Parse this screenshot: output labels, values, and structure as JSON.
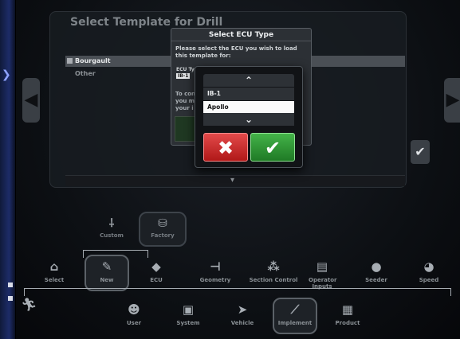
{
  "background_screen": {
    "title": "Select Template for Drill",
    "rows": [
      "Bourgault",
      "Other"
    ]
  },
  "dialog": {
    "title": "Select ECU Type",
    "message": "Please select the ECU you wish to load this template for:",
    "ecu_label": "ECU Ty",
    "ecu_value": "IB-1",
    "note": "To con you mi your i"
  },
  "dropdown": {
    "options": [
      "IB-1",
      "Apollo"
    ],
    "selected": "Apollo",
    "up_symbol": "⌃",
    "down_symbol": "⌄",
    "cancel_symbol": "✖",
    "ok_symbol": "✔"
  },
  "template_source": {
    "items": [
      {
        "label": "Custom",
        "icon": "custom-icon"
      },
      {
        "label": "Factory",
        "icon": "factory-icon"
      }
    ]
  },
  "setup_tabs": [
    {
      "label": "Select",
      "icon": "select-icon"
    },
    {
      "label": "New",
      "icon": "new-icon"
    },
    {
      "label": "ECU",
      "icon": "ecu-icon"
    },
    {
      "label": "Geometry",
      "icon": "geometry-icon"
    },
    {
      "label": "Section Control",
      "icon": "section-control-icon"
    },
    {
      "label": "Operator Inputs",
      "icon": "operator-inputs-icon"
    },
    {
      "label": "Seeder",
      "icon": "seeder-icon"
    },
    {
      "label": "Speed",
      "icon": "speed-icon"
    }
  ],
  "main_tabs": [
    {
      "label": "User",
      "icon": "user-icon"
    },
    {
      "label": "System",
      "icon": "system-icon"
    },
    {
      "label": "Vehicle",
      "icon": "vehicle-icon"
    },
    {
      "label": "Implement",
      "icon": "implement-icon"
    },
    {
      "label": "Product",
      "icon": "product-icon"
    }
  ],
  "colors": {
    "cancel": "#c62828",
    "ok": "#2e8b34",
    "selection": "#fafafa"
  }
}
